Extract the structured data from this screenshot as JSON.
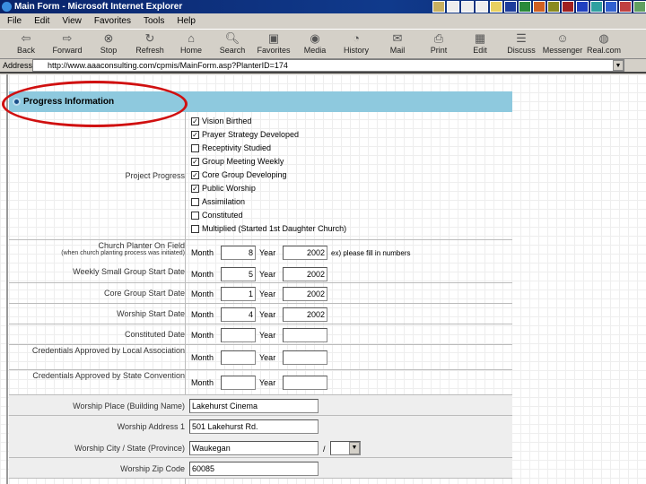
{
  "window": {
    "title": "Main Form - Microsoft Internet Explorer"
  },
  "menu": [
    "File",
    "Edit",
    "View",
    "Favorites",
    "Tools",
    "Help"
  ],
  "toolbar": [
    {
      "label": "Back",
      "icon": "back-arrow-icon"
    },
    {
      "label": "Forward",
      "icon": "forward-arrow-icon"
    },
    {
      "label": "Stop",
      "icon": "stop-icon"
    },
    {
      "label": "Refresh",
      "icon": "refresh-icon"
    },
    {
      "label": "Home",
      "icon": "home-icon"
    },
    {
      "label": "Search",
      "icon": "search-icon"
    },
    {
      "label": "Favorites",
      "icon": "favorites-icon"
    },
    {
      "label": "Media",
      "icon": "media-icon"
    },
    {
      "label": "History",
      "icon": "history-icon"
    },
    {
      "label": "Mail",
      "icon": "mail-icon"
    },
    {
      "label": "Print",
      "icon": "print-icon"
    },
    {
      "label": "Edit",
      "icon": "edit-icon"
    },
    {
      "label": "Discuss",
      "icon": "discuss-icon"
    },
    {
      "label": "Messenger",
      "icon": "messenger-icon"
    },
    {
      "label": "Real.com",
      "icon": "realcom-icon"
    }
  ],
  "address": {
    "label": "Address",
    "url": "http://www.aaaconsulting.com/cpmis/MainForm.asp?PlanterID=174"
  },
  "section": {
    "title": "Progress Information"
  },
  "progress": {
    "label": "Project Progress",
    "items": [
      {
        "label": "Vision Birthed",
        "checked": true
      },
      {
        "label": "Prayer Strategy Developed",
        "checked": true
      },
      {
        "label": "Receptivity Studied",
        "checked": false
      },
      {
        "label": "Group Meeting Weekly",
        "checked": true
      },
      {
        "label": "Core Group Developing",
        "checked": true
      },
      {
        "label": "Public Worship",
        "checked": true
      },
      {
        "label": "Assimilation",
        "checked": false
      },
      {
        "label": "Constituted",
        "checked": false
      },
      {
        "label": "Multiplied (Started 1st Daughter Church)",
        "checked": false
      }
    ]
  },
  "month_label": "Month",
  "year_label": "Year",
  "dates": [
    {
      "label": "Church Planter On Field",
      "sublabel": "(when church planting process was initiated)",
      "month": "8",
      "year": "2002",
      "hint": "ex) please fill in numbers"
    },
    {
      "label": "Weekly Small Group Start Date",
      "month": "5",
      "year": "2002"
    },
    {
      "label": "Core Group Start Date",
      "month": "1",
      "year": "2002"
    },
    {
      "label": "Worship Start Date",
      "month": "4",
      "year": "2002"
    },
    {
      "label": "Constituted Date",
      "month": "",
      "year": ""
    },
    {
      "label": "Credentials Approved by Local Association",
      "month": "",
      "year": ""
    },
    {
      "label": "Credentials Approved by State Convention",
      "month": "",
      "year": ""
    }
  ],
  "worship": {
    "place_label": "Worship Place (Building Name)",
    "place": "Lakehurst Cinema",
    "address_label": "Worship Address 1",
    "address": "501 Lakehurst Rd.",
    "city_label": "Worship City / State (Province)",
    "city": "Waukegan",
    "separator": "/",
    "state": "",
    "zip_label": "Worship Zip Code",
    "zip": "60085"
  }
}
